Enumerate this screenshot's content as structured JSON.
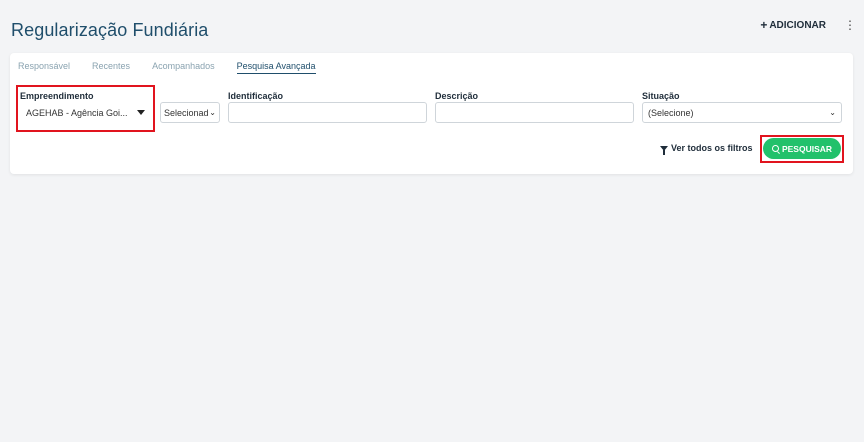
{
  "header": {
    "title": "Regularização Fundiária",
    "add_label": "ADICIONAR",
    "add_plus": "+",
    "more_icon": "⋮"
  },
  "tabs": [
    {
      "label": "Responsável",
      "active": false
    },
    {
      "label": "Recentes",
      "active": false
    },
    {
      "label": "Acompanhados",
      "active": false
    },
    {
      "label": "Pesquisa Avançada",
      "active": true
    }
  ],
  "filters": {
    "empreendimento": {
      "label": "Empreendimento",
      "value": "AGEHAB - Agência Goi..."
    },
    "secondary_select": {
      "value": "Selecionado"
    },
    "identificacao": {
      "label": "Identificação",
      "value": ""
    },
    "descricao": {
      "label": "Descrição",
      "value": ""
    },
    "situacao": {
      "label": "Situação",
      "value": "(Selecione)"
    }
  },
  "actions": {
    "view_filters_label": "Ver todos os filtros",
    "search_label": "PESQUISAR"
  },
  "colors": {
    "title": "#1f4e6b",
    "search_button": "#22c16b",
    "highlight": "#e1141e"
  }
}
